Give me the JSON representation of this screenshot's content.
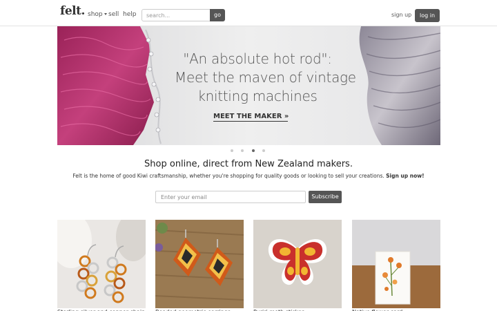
{
  "header": {
    "logo": "felt.",
    "nav": {
      "shop": "shop",
      "sell": "sell",
      "help": "help"
    },
    "search": {
      "placeholder": "search...",
      "value": "",
      "button": "go"
    },
    "signup": "sign up",
    "login": "log in"
  },
  "hero": {
    "quote_lines": [
      "\"An absolute hot rod\":",
      "Meet the maven of vintage",
      "knitting machines"
    ],
    "cta": "MEET THE MAKER »",
    "active_slide": 3,
    "slide_count": 4
  },
  "intro": {
    "title": "Shop online, direct from New Zealand makers.",
    "subtitle": "Felt is the home of good Kiwi craftsmanship, whether you're shopping for quality goods or looking to sell your creations.",
    "signup_cta": "Sign up now!"
  },
  "subscribe": {
    "placeholder": "Enter your email",
    "value": "",
    "button": "Subscribe"
  },
  "products": [
    {
      "title": "Sterling silver and copper chain earrings"
    },
    {
      "title": "Beaded geometric earrings"
    },
    {
      "title": "Puriri moth sticker"
    },
    {
      "title": "Native flower card"
    }
  ],
  "colors": {
    "button": "#555555",
    "yarn_pink": "#b0306a",
    "moth_red": "#c9302c",
    "moth_yellow": "#f2b632"
  }
}
